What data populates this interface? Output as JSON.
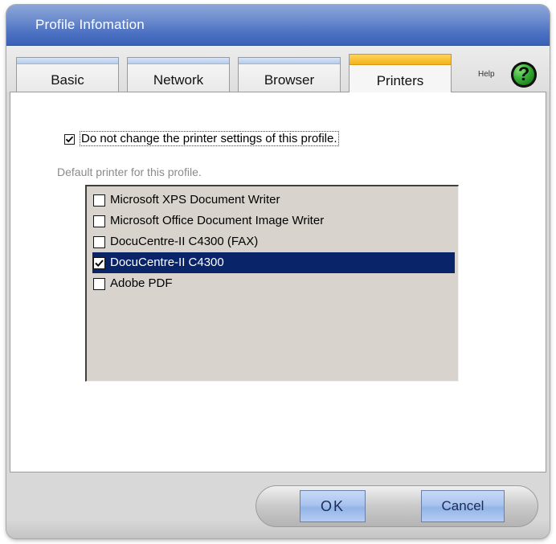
{
  "window": {
    "title": "Profile Infomation"
  },
  "tabs": [
    {
      "label": "Basic",
      "active": false
    },
    {
      "label": "Network",
      "active": false
    },
    {
      "label": "Browser",
      "active": false
    },
    {
      "label": "Printers",
      "active": true
    }
  ],
  "help": {
    "label": "Help",
    "icon": "help-question-icon",
    "glyph": "?"
  },
  "printers": {
    "do_not_change_label": "Do not change the printer settings of this profile.",
    "do_not_change_checked": true,
    "default_label": "Default printer for this profile.",
    "items": [
      {
        "label": "Microsoft XPS Document Writer",
        "checked": false,
        "selected": false
      },
      {
        "label": "Microsoft Office Document Image Writer",
        "checked": false,
        "selected": false
      },
      {
        "label": "DocuCentre-II C4300 (FAX)",
        "checked": false,
        "selected": false
      },
      {
        "label": "DocuCentre-II C4300",
        "checked": true,
        "selected": true
      },
      {
        "label": "Adobe PDF",
        "checked": false,
        "selected": false
      }
    ]
  },
  "buttons": {
    "ok": "OK",
    "cancel": "Cancel"
  },
  "colors": {
    "titlebar": "#4c71c2",
    "active_tab_stripe": "#f3b21a",
    "selection": "#0a246a",
    "list_background": "#d8d4cd"
  }
}
